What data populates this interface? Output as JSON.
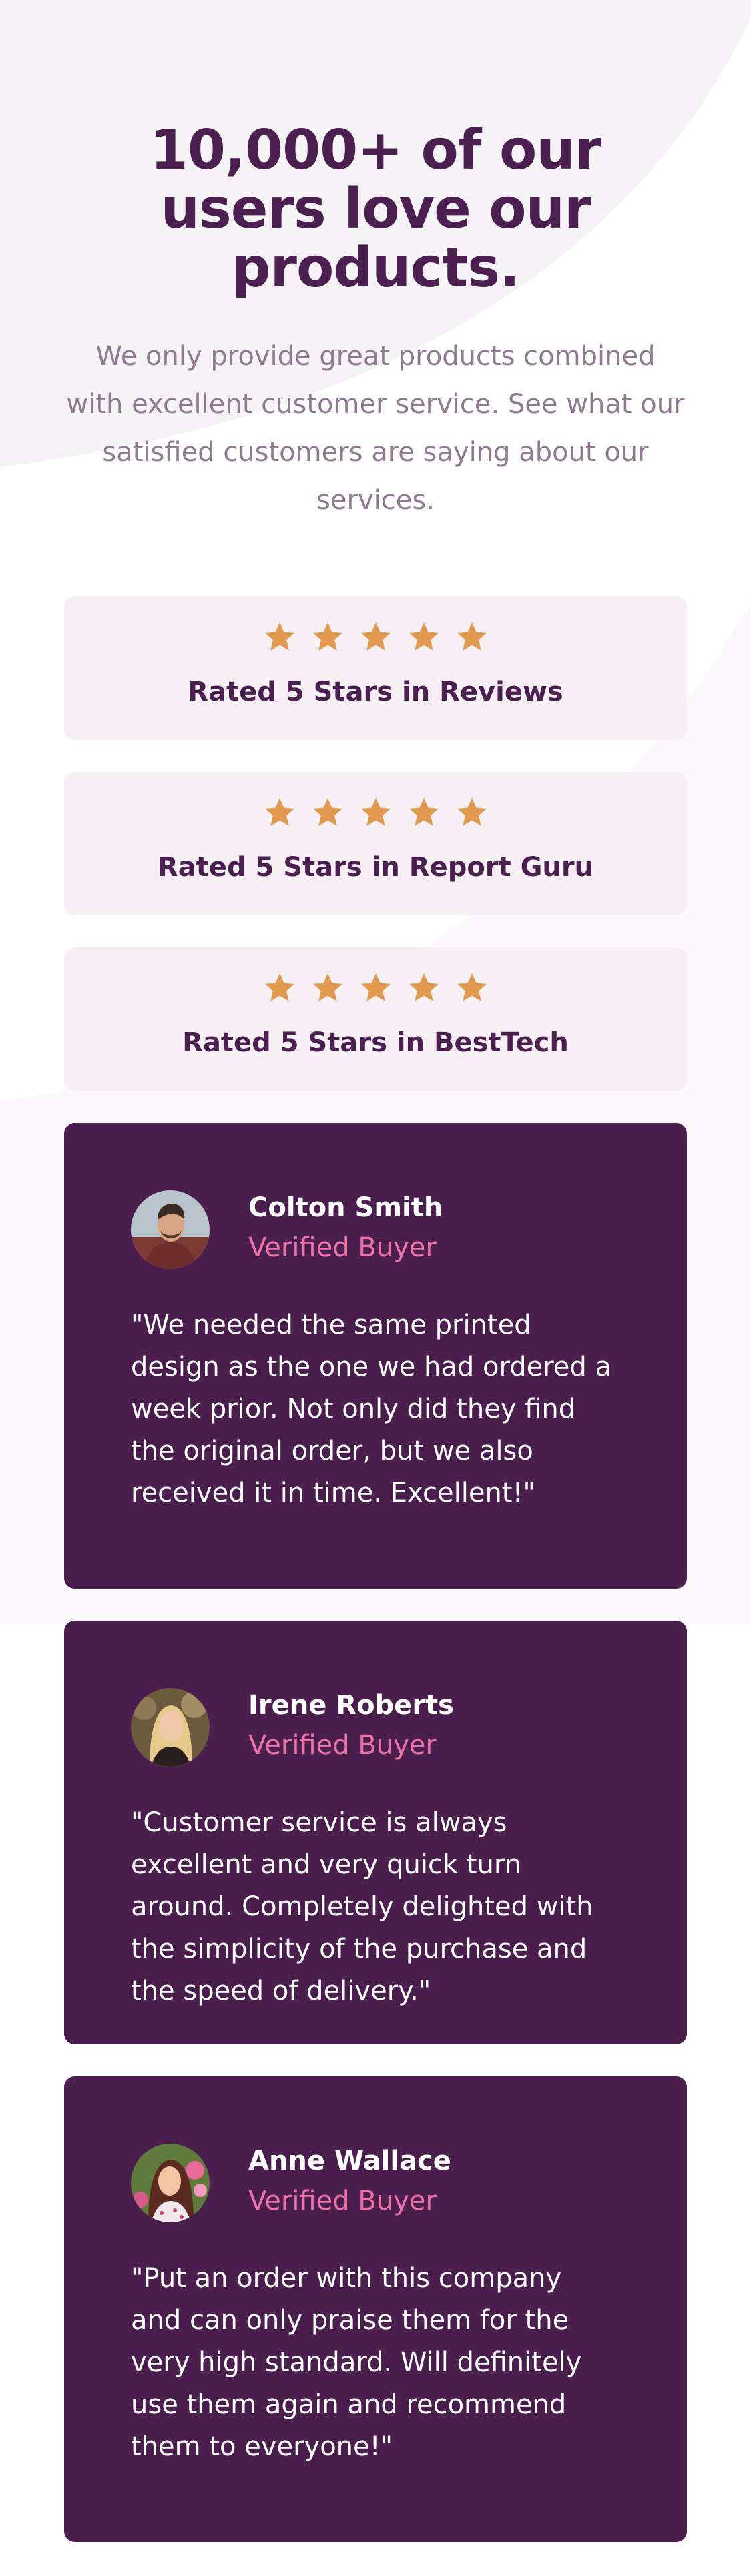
{
  "header": {
    "headline": "10,000+ of our users love our products.",
    "intro": "We only provide great products combined with excellent customer service. See what our satisfied customers are saying about our services."
  },
  "ratings": [
    {
      "label": "Rated 5 Stars in Reviews",
      "stars": 5
    },
    {
      "label": "Rated 5 Stars in Report Guru",
      "stars": 5
    },
    {
      "label": "Rated 5 Stars in BestTech",
      "stars": 5
    }
  ],
  "testimonials": [
    {
      "name": "Colton Smith",
      "status": "Verified Buyer",
      "quote": "\"We needed the same printed design as the one we had ordered a week prior. Not only did they find the original order, but we also received it in time. Excellent!\""
    },
    {
      "name": "Irene Roberts",
      "status": "Verified Buyer",
      "quote": "\"Customer service is always excellent and very quick turn around. Completely delighted with the simplicity of the purchase and the speed of delivery.\""
    },
    {
      "name": "Anne Wallace",
      "status": "Verified Buyer",
      "quote": "\"Put an order with this company and can only praise them for the very high standard. Will definitely use them again and recommend them to everyone!\""
    }
  ],
  "colors": {
    "heading": "#4b1f4f",
    "body_muted": "#8f7a92",
    "star": "#e29a50",
    "rating_card_bg": "#f6f0f5",
    "testimonial_bg": "#4a1f4e",
    "accent_pink": "#ee74a8"
  }
}
